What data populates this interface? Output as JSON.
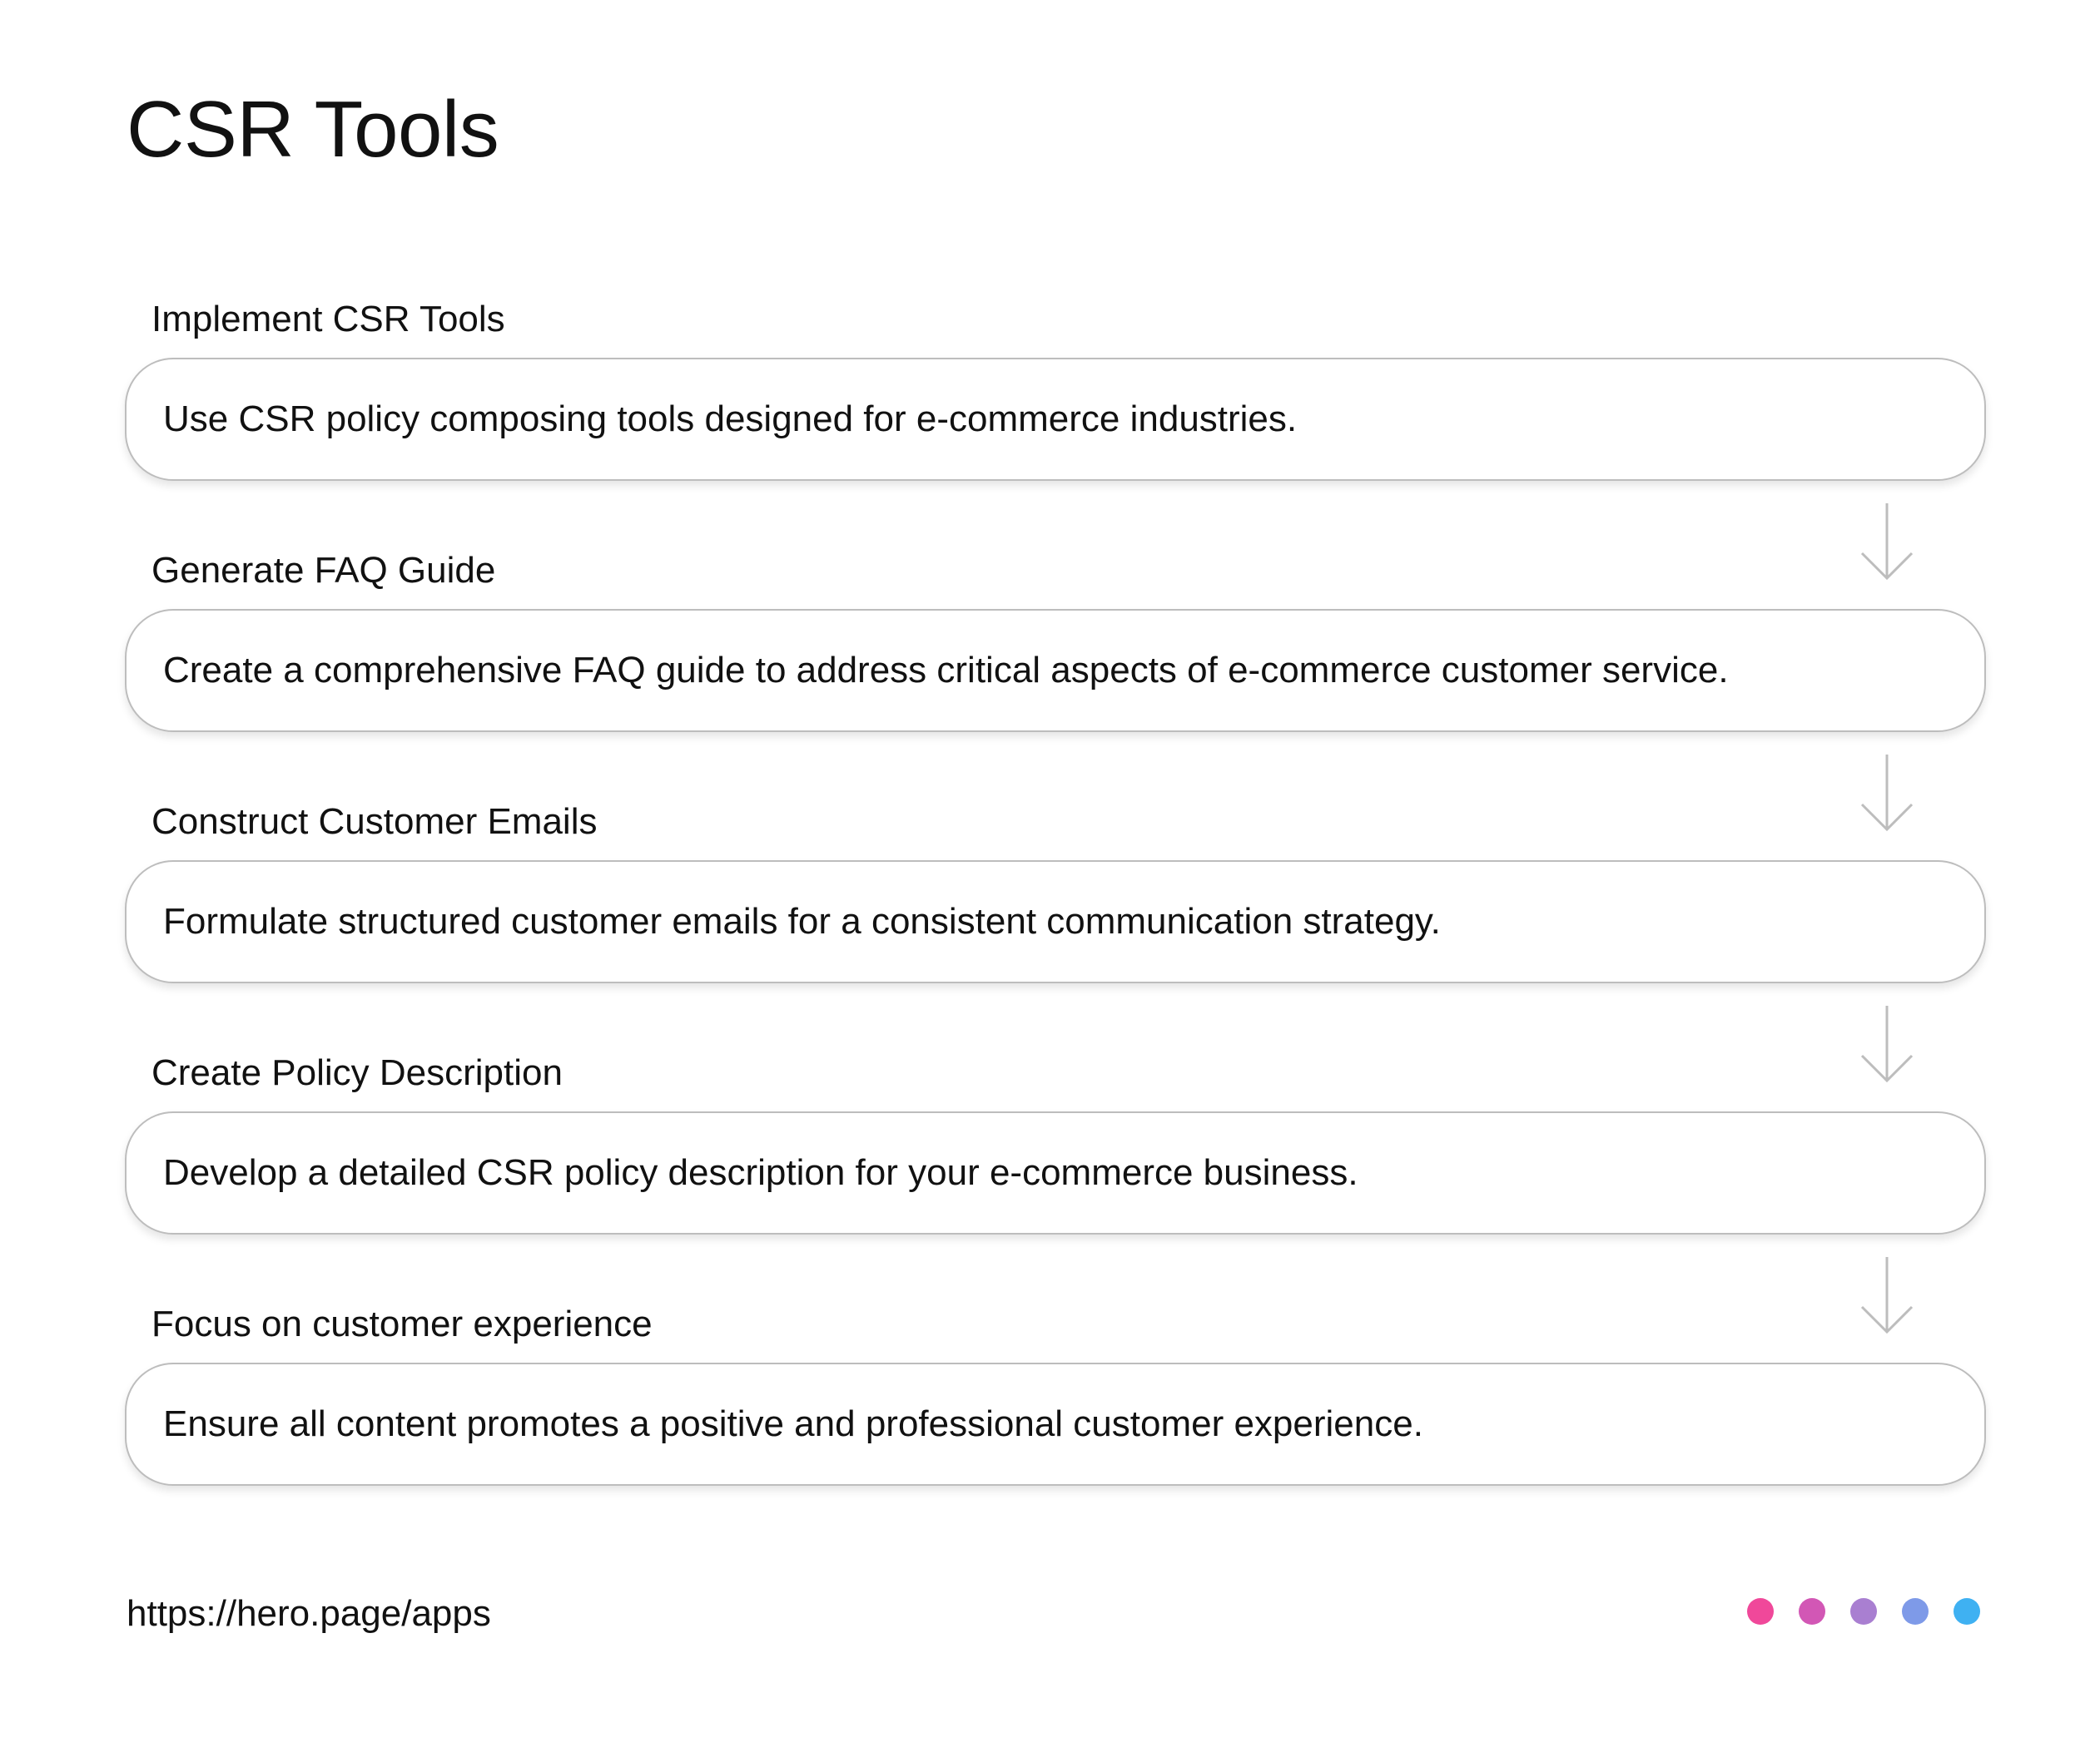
{
  "title": "CSR Tools",
  "steps": [
    {
      "label": "Implement CSR Tools",
      "description": "Use CSR policy composing tools designed for e-commerce industries."
    },
    {
      "label": "Generate FAQ Guide",
      "description": "Create a comprehensive FAQ guide to address critical aspects of e-commerce customer service."
    },
    {
      "label": "Construct Customer Emails",
      "description": "Formulate structured customer emails for a consistent communication strategy."
    },
    {
      "label": "Create Policy Description",
      "description": "Develop a detailed CSR policy description for your e-commerce business."
    },
    {
      "label": "Focus on customer experience",
      "description": "Ensure all content promotes a positive and professional customer experience."
    }
  ],
  "footer": {
    "url": "https://hero.page/apps"
  },
  "icons": {
    "connector": "arrow-down-icon"
  },
  "colors": {
    "box_border": "#bdbdbd",
    "arrow": "#bdbdbd",
    "dots": [
      "#f0489a",
      "#d257b5",
      "#a97fd1",
      "#7e9ae8",
      "#3fb1f2"
    ]
  }
}
